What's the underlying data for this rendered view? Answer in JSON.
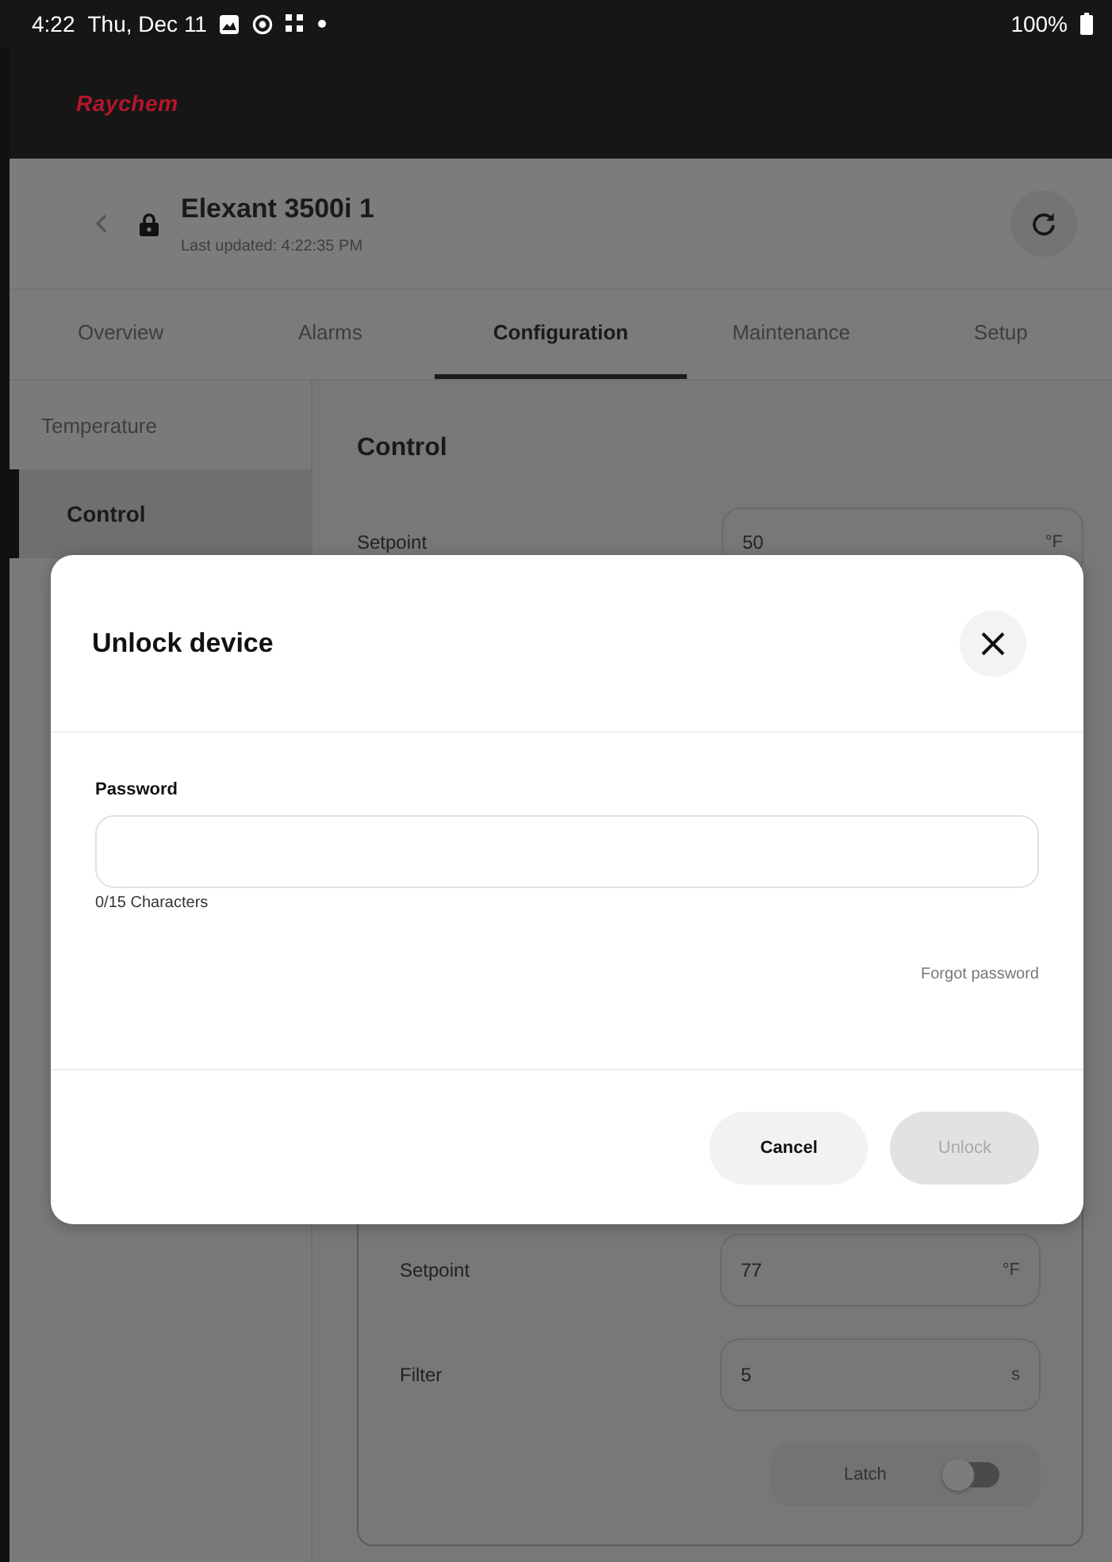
{
  "status_bar": {
    "time": "4:22",
    "date": "Thu, Dec 11",
    "battery": "100%"
  },
  "app_bar": {
    "logo": "Raychem"
  },
  "header": {
    "title": "Elexant 3500i 1",
    "subtitle": "Last updated: 4:22:35 PM"
  },
  "tabs": [
    {
      "label": "Overview",
      "selected": false
    },
    {
      "label": "Alarms",
      "selected": false
    },
    {
      "label": "Configuration",
      "selected": true
    },
    {
      "label": "Maintenance",
      "selected": false
    },
    {
      "label": "Setup",
      "selected": false
    }
  ],
  "sidebar": {
    "items": [
      {
        "label": "Temperature",
        "selected": false
      },
      {
        "label": "Control",
        "selected": true
      }
    ]
  },
  "content": {
    "heading": "Control",
    "fields": [
      {
        "label": "Setpoint",
        "value": "50",
        "unit": "°F"
      }
    ],
    "card": {
      "rows": [
        {
          "kind": "number",
          "label": "Setpoint",
          "value": "77",
          "unit": "°F"
        },
        {
          "kind": "number",
          "label": "Filter",
          "value": "5",
          "unit": "s"
        },
        {
          "kind": "toggle",
          "label": "Latch",
          "on": false
        }
      ]
    }
  },
  "dialog": {
    "title": "Unlock device",
    "field_label": "Password",
    "counter": "0/15 Characters",
    "link": "Forgot password",
    "buttons": [
      {
        "label": "Cancel",
        "disabled": false
      },
      {
        "label": "Unlock",
        "disabled": true
      }
    ]
  }
}
